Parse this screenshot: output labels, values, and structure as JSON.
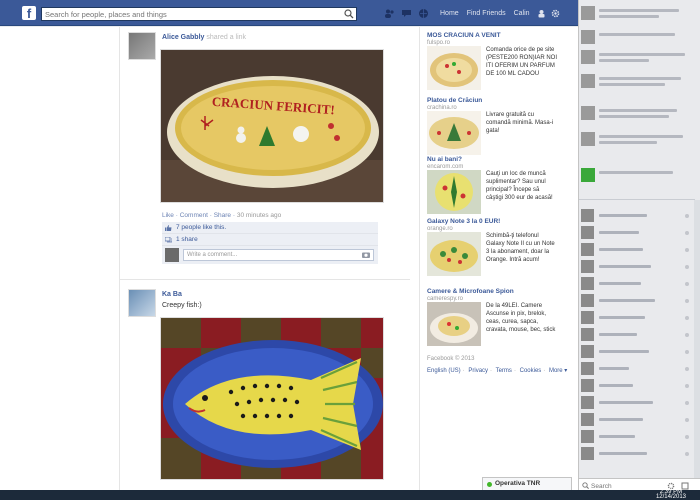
{
  "topbar": {
    "search_placeholder": "Search for people, places and things",
    "nav": [
      "Home",
      "Find Friends",
      "Calin"
    ],
    "logo": "f"
  },
  "post1": {
    "author": "Alice Gabbly",
    "author_suffix": "shared a link",
    "actions": [
      "Like",
      "Comment",
      "Share"
    ],
    "time": "30 minutes ago",
    "likes": "7 people like this.",
    "shares": "1 share",
    "comment_placeholder": "Write a comment...",
    "photo_text": "CRACIUN FERICIT!"
  },
  "post2": {
    "author": "Ka Ba",
    "text": "Creepy fish:)"
  },
  "ads": [
    {
      "title": "MOS CRACIUN A VENIT",
      "domain": "fulspo.ro",
      "text": "Comanda orice de pe site (PESTE200 RON)IAR NOI ITI OFERIM UN PARFUM DE 100 ML CADOU"
    },
    {
      "title": "Platou de Crăciun",
      "domain": "crachina.ro",
      "text": "Livrare gratuită cu comandă minimă. Masa-i gata!"
    },
    {
      "title": "Nu ai bani?",
      "domain": "encarom.com",
      "text": "Cauţi un loc de muncă suplimentar? Sau unul principal? Începe să câştigi 300 eur de acasă!"
    },
    {
      "title": "Galaxy Note 3 la 0 EUR!",
      "domain": "orange.ro",
      "text": "Schimbă-ţi telefonul Galaxy Note II cu un Note 3 la abonament, doar la Orange. Intră acum!"
    },
    {
      "title": "Camere & Microfoane Spion",
      "domain": "camerespy.ro",
      "text": "De la 49LEI. Camere Ascunse in pix, brelok, ceas, curea, sapca, cravata, mouse, bec, stick"
    }
  ],
  "footer": {
    "copyright": "Facebook © 2013",
    "links": [
      "English (US)",
      "Privacy",
      "Terms",
      "Cookies",
      "More ▾"
    ]
  },
  "chat": {
    "tab_label": "Operativa TNR",
    "search_placeholder": "Search"
  },
  "clock": {
    "time": "2:39 PM",
    "date": "12/14/2013"
  },
  "colors": {
    "brand": "#3b5998",
    "link": "#3b5998",
    "online": "#42b72a"
  }
}
